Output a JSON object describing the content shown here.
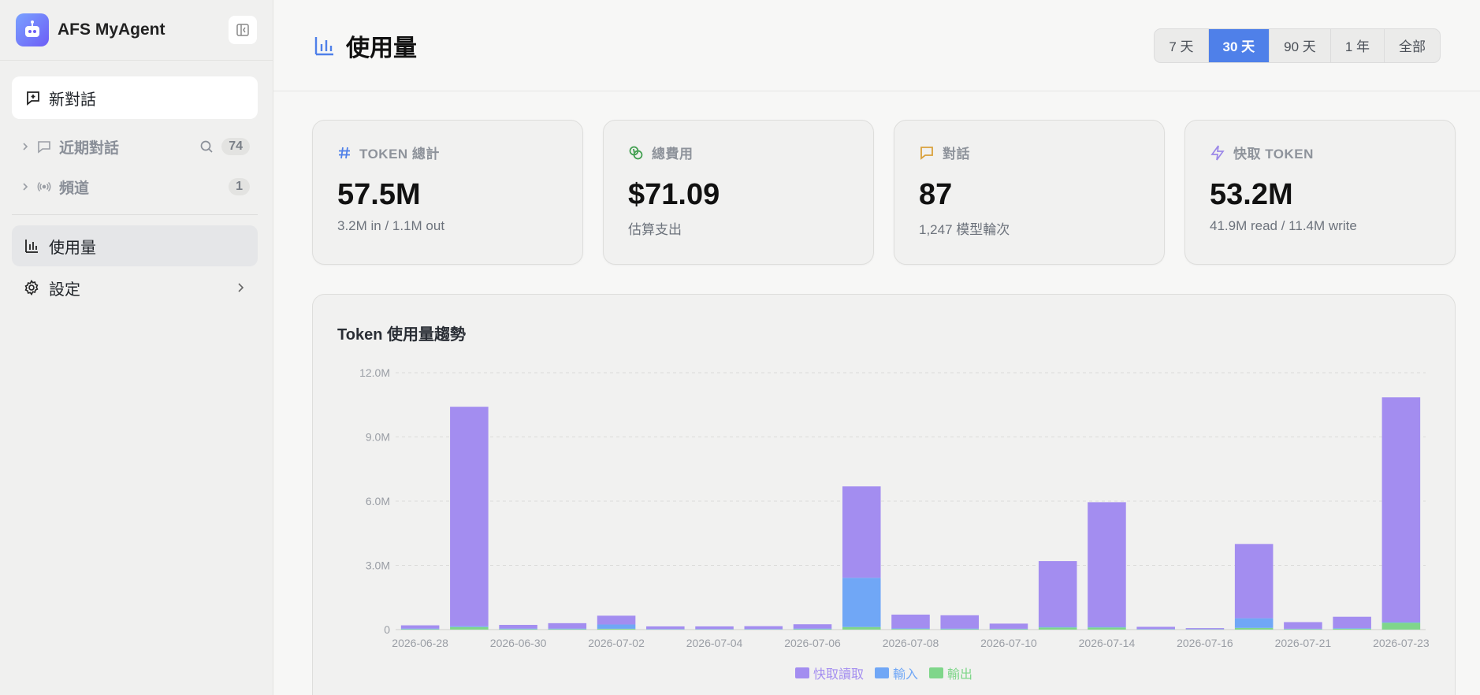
{
  "app": {
    "name": "AFS MyAgent"
  },
  "sidebar": {
    "new_chat_label": "新對話",
    "recent": {
      "label": "近期對話",
      "count": "74"
    },
    "channels": {
      "label": "頻道",
      "count": "1"
    },
    "items": [
      {
        "label": "使用量",
        "icon": "bar-chart-icon",
        "active": true
      },
      {
        "label": "設定",
        "icon": "gear-icon"
      }
    ]
  },
  "header": {
    "title": "使用量",
    "ranges": [
      "7 天",
      "30 天",
      "90 天",
      "1 年",
      "全部"
    ],
    "active_range": "30 天"
  },
  "stats": [
    {
      "label": "TOKEN 總計",
      "value": "57.5M",
      "sub": "3.2M in / 1.1M out",
      "icon": "hash-icon",
      "color": "#4f80e9"
    },
    {
      "label": "總費用",
      "value": "$71.09",
      "sub": "估算支出",
      "icon": "coins-icon",
      "color": "#3f9e4d"
    },
    {
      "label": "對話",
      "value": "87",
      "sub": "1,247 模型輪次",
      "icon": "message-icon",
      "color": "#d9a13b"
    },
    {
      "label": "快取 TOKEN",
      "value": "53.2M",
      "sub": "41.9M read / 11.4M write",
      "icon": "lightning-icon",
      "color": "#9b87e8"
    }
  ],
  "chart_title": "Token 使用量趨勢",
  "chart_data": {
    "type": "bar",
    "stacked": true,
    "categories": [
      "2026-06-28",
      "2026-06-29",
      "2026-06-30",
      "2026-07-01",
      "2026-07-02",
      "2026-07-03",
      "2026-07-04",
      "2026-07-05",
      "2026-07-06",
      "2026-07-07",
      "2026-07-08",
      "2026-07-09",
      "2026-07-10",
      "2026-07-11",
      "2026-07-14",
      "2026-07-15",
      "2026-07-16",
      "2026-07-17",
      "2026-07-21",
      "2026-07-22",
      "2026-07-23"
    ],
    "x_tick_labels": [
      "2026-06-28",
      "2026-06-30",
      "2026-07-02",
      "2026-07-04",
      "2026-07-06",
      "2026-07-08",
      "2026-07-10",
      "2026-07-14",
      "2026-07-16",
      "2026-07-21",
      "2026-07-23"
    ],
    "series": [
      {
        "name": "輸出",
        "color": "#7fd68a",
        "values": [
          0.02,
          0.12,
          0.02,
          0.02,
          0.04,
          0.01,
          0.01,
          0.01,
          0.02,
          0.12,
          0.03,
          0.02,
          0.02,
          0.1,
          0.1,
          0.01,
          0.01,
          0.08,
          0.02,
          0.04,
          0.32
        ]
      },
      {
        "name": "輸入",
        "color": "#70a7f6",
        "values": [
          0.03,
          0.04,
          0.03,
          0.03,
          0.2,
          0.02,
          0.02,
          0.02,
          0.03,
          2.3,
          0.03,
          0.03,
          0.02,
          0.03,
          0.03,
          0.02,
          0.01,
          0.45,
          0.02,
          0.03,
          0.03
        ]
      },
      {
        "name": "快取讀取",
        "color": "#a38df0",
        "values": [
          0.15,
          10.25,
          0.17,
          0.25,
          0.41,
          0.12,
          0.12,
          0.13,
          0.2,
          4.27,
          0.64,
          0.62,
          0.24,
          3.07,
          5.82,
          0.1,
          0.05,
          3.47,
          0.31,
          0.53,
          10.5
        ]
      }
    ],
    "legend_order": [
      "快取讀取",
      "輸入",
      "輸出"
    ],
    "y_ticks": [
      "12.0M",
      "9.0M",
      "6.0M",
      "3.0M",
      "0"
    ],
    "ylim": [
      0,
      12
    ],
    "grid": true,
    "legend_position": "bottom"
  }
}
